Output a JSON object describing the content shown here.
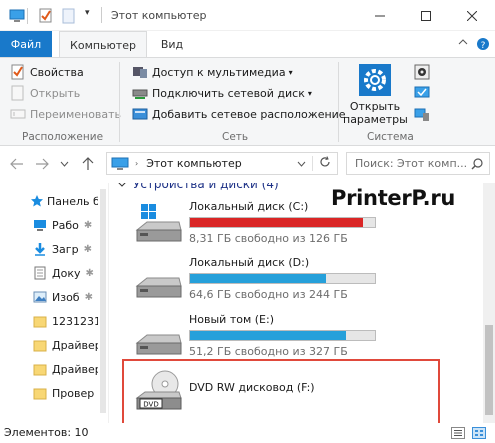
{
  "window": {
    "title": "Этот компьютер",
    "controls": [
      "minimize",
      "maximize",
      "close"
    ]
  },
  "ribbon_tabs": {
    "file": "Файл",
    "computer": "Компьютер",
    "view": "Вид"
  },
  "ribbon": {
    "location": {
      "label": "Расположение",
      "properties": "Свойства",
      "open": "Открыть",
      "rename": "Переименовать"
    },
    "network": {
      "label": "Сеть",
      "media_access": "Доступ к мультимедиа",
      "map_drive": "Подключить сетевой диск",
      "add_location": "Добавить сетевое расположение"
    },
    "system": {
      "label": "Система",
      "open_settings_line1": "Открыть",
      "open_settings_line2": "параметры"
    }
  },
  "address_bar": {
    "path": "Этот компьютер",
    "search_placeholder": "Поиск: Этот комп..."
  },
  "nav_pane": {
    "items": [
      {
        "label": "Панель б",
        "icon": "star-icon",
        "pinned": false
      },
      {
        "label": "Рабо",
        "icon": "desktop-icon",
        "pinned": true
      },
      {
        "label": "Загр",
        "icon": "download-icon",
        "pinned": true
      },
      {
        "label": "Доку",
        "icon": "document-icon",
        "pinned": true
      },
      {
        "label": "Изоб",
        "icon": "picture-icon",
        "pinned": true
      },
      {
        "label": "1231231",
        "icon": "folder-icon",
        "pinned": false
      },
      {
        "label": "Драйвер",
        "icon": "folder-icon",
        "pinned": false
      },
      {
        "label": "Драйвер",
        "icon": "folder-icon",
        "pinned": false
      },
      {
        "label": "Провер",
        "icon": "folder-icon",
        "pinned": false
      }
    ]
  },
  "content": {
    "group_header": "Устройства и диски (4)",
    "drives": [
      {
        "name": "Локальный диск (C:)",
        "free_text": "8,31 ГБ свободно из 126 ГБ",
        "used_fraction": 0.934,
        "bar_color": "#da2626",
        "icon": "windows-drive-icon"
      },
      {
        "name": "Локальный диск (D:)",
        "free_text": "64,6 ГБ свободно из 244 ГБ",
        "used_fraction": 0.735,
        "bar_color": "#26a0da",
        "icon": "hard-drive-icon"
      },
      {
        "name": "Новый том (E:)",
        "free_text": "51,2 ГБ свободно из 327 ГБ",
        "used_fraction": 0.843,
        "bar_color": "#26a0da",
        "icon": "hard-drive-icon"
      },
      {
        "name": "DVD RW дисковод (F:)",
        "icon": "dvd-drive-icon",
        "dvd_label": "DVD"
      }
    ]
  },
  "status_bar": {
    "items_count": "Элементов: 10"
  },
  "watermark": "PrinterP.ru"
}
